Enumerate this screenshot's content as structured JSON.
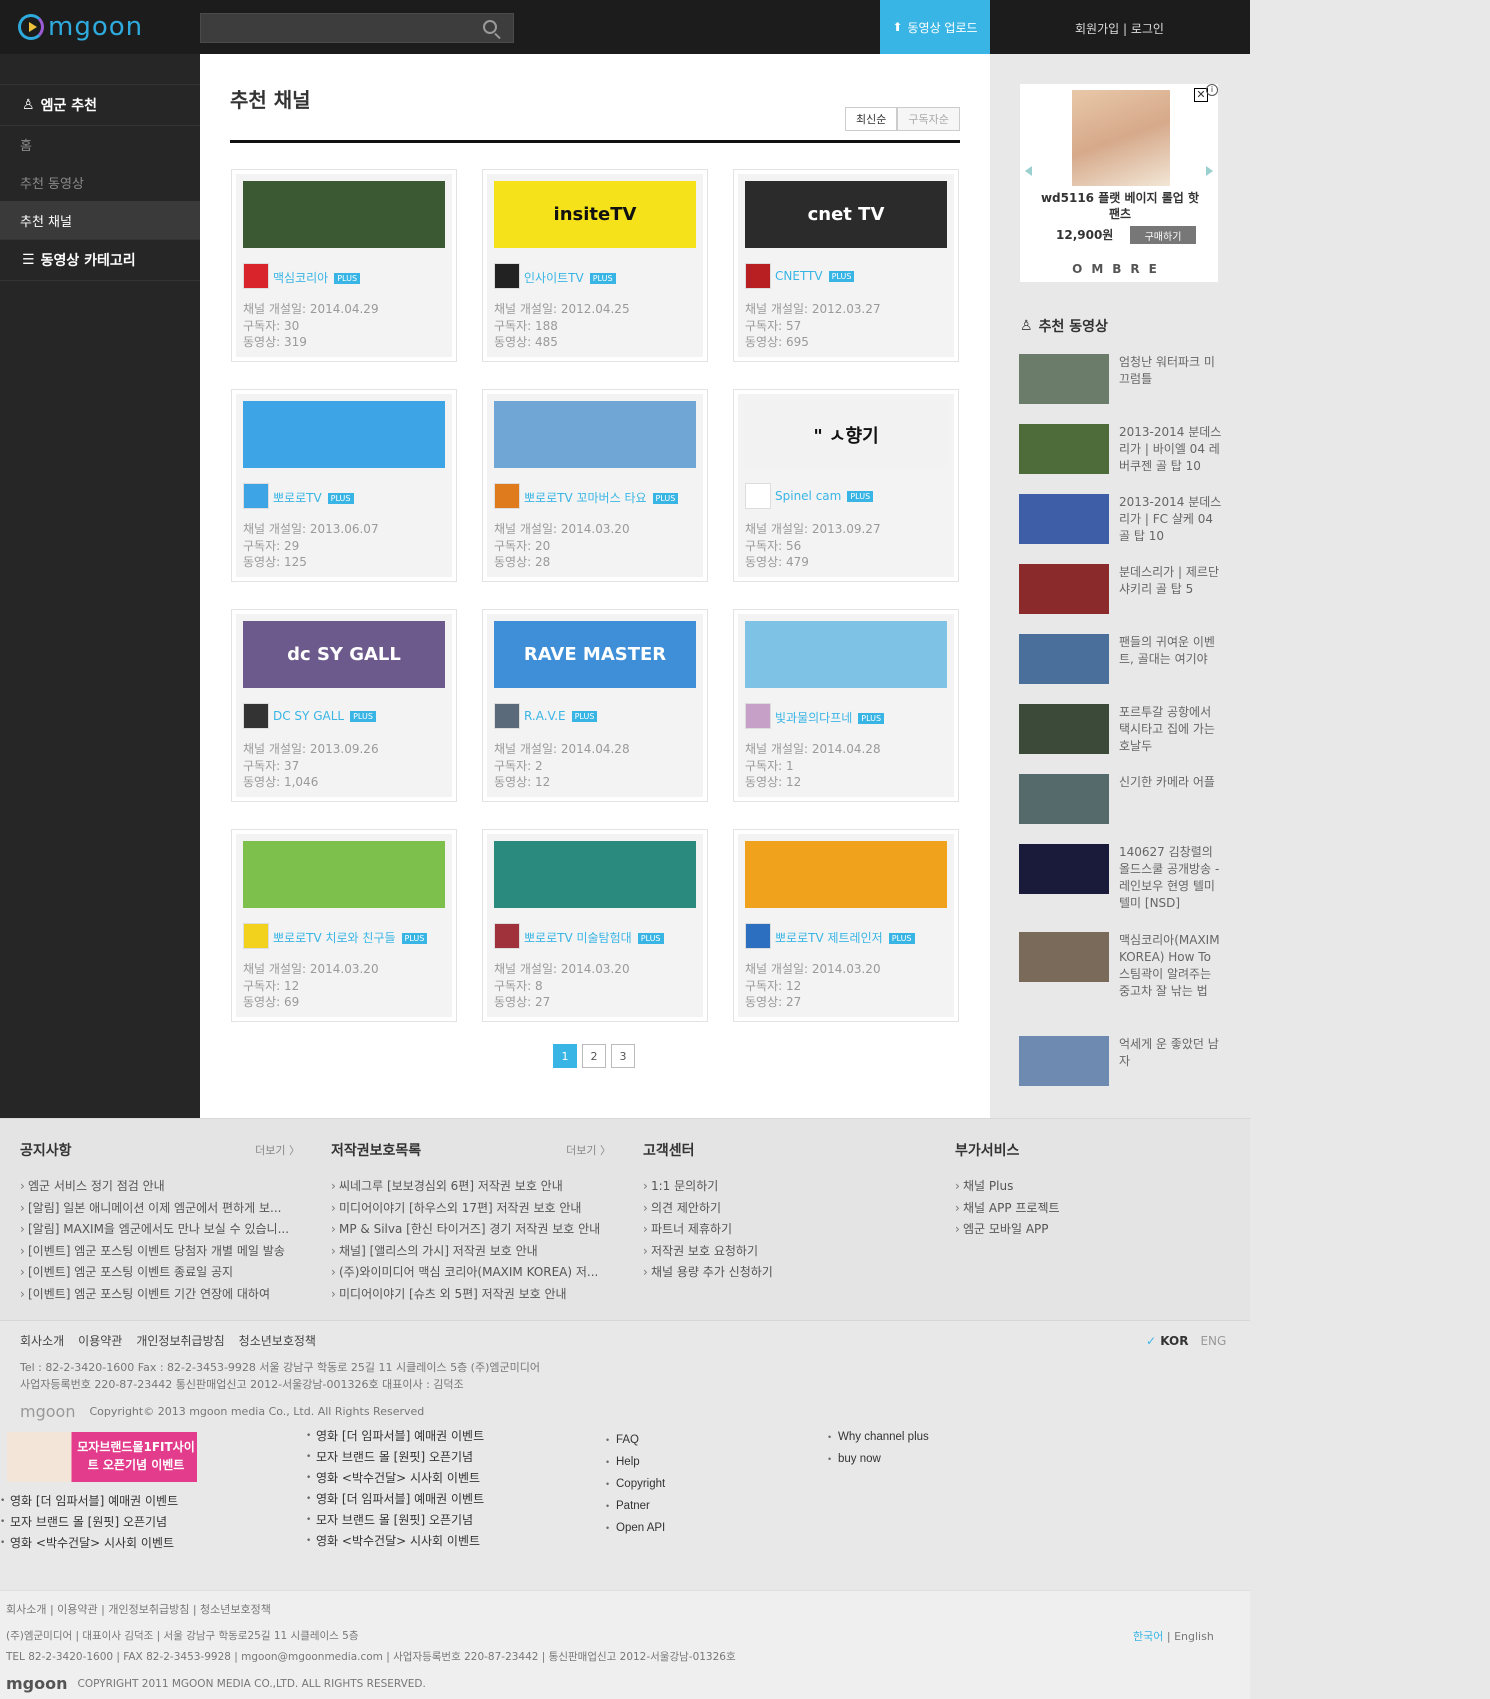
{
  "header": {
    "logo": "mgoon",
    "search_placeholder": "",
    "upload_label": "동영상 업로드",
    "login_label": "회원가입 | 로그인"
  },
  "sidebar": {
    "section1": "엠군 추천",
    "items": [
      {
        "label": "홈",
        "active": false
      },
      {
        "label": "추천 동영상",
        "active": false
      },
      {
        "label": "추천 채널",
        "active": true
      }
    ],
    "section2": "동영상 카테고리"
  },
  "main": {
    "title": "추천 채널",
    "sort": [
      {
        "label": "최신순",
        "active": true
      },
      {
        "label": "구독자순",
        "active": false
      }
    ],
    "channels": [
      {
        "name": "맥심코리아",
        "plus": "PLUS",
        "opened": "채널 개설일: 2014.04.29",
        "subs": "구독자: 30",
        "videos": "동영상: 319",
        "banner_color": "#3b5a33",
        "banner_text": "",
        "icon_color": "#d8242a"
      },
      {
        "name": "인사이트TV",
        "plus": "PLUS",
        "opened": "채널 개설일: 2012.04.25",
        "subs": "구독자: 188",
        "videos": "동영상: 485",
        "banner_color": "#f5e21a",
        "banner_text": "insiteTV",
        "icon_color": "#222222"
      },
      {
        "name": "CNETTV",
        "plus": "PLUS",
        "opened": "채널 개설일: 2012.03.27",
        "subs": "구독자: 57",
        "videos": "동영상: 695",
        "banner_color": "#2b2b2b",
        "banner_text": "cnet TV",
        "icon_color": "#b81f23"
      },
      {
        "name": "뽀로로TV",
        "plus": "PLUS",
        "opened": "채널 개설일: 2013.06.07",
        "subs": "구독자: 29",
        "videos": "동영상: 125",
        "banner_color": "#3da5e6",
        "banner_text": "",
        "icon_color": "#3da5e6"
      },
      {
        "name": "뽀로로TV 꼬마버스 타요",
        "plus": "PLUS",
        "opened": "채널 개설일: 2014.03.20",
        "subs": "구독자: 20",
        "videos": "동영상: 28",
        "banner_color": "#6fa6d6",
        "banner_text": "",
        "icon_color": "#e07b1d"
      },
      {
        "name": "Spinel cam",
        "plus": "PLUS",
        "opened": "채널 개설일: 2013.09.27",
        "subs": "구독자: 56",
        "videos": "동영상: 479",
        "banner_color": "#f2f2f2",
        "banner_text": "\" ㅅ향기",
        "icon_color": "#ffffff"
      },
      {
        "name": "DC SY GALL",
        "plus": "PLUS",
        "opened": "채널 개설일: 2013.09.26",
        "subs": "구독자: 37",
        "videos": "동영상: 1,046",
        "banner_color": "#6d5a8c",
        "banner_text": "dc SY GALL",
        "icon_color": "#333333"
      },
      {
        "name": "R.A.V.E",
        "plus": "PLUS",
        "opened": "채널 개설일: 2014.04.28",
        "subs": "구독자: 2",
        "videos": "동영상: 12",
        "banner_color": "#3e8fd8",
        "banner_text": "RAVE MASTER",
        "icon_color": "#5a6a7a"
      },
      {
        "name": "빛과물의다프네",
        "plus": "PLUS",
        "opened": "채널 개설일: 2014.04.28",
        "subs": "구독자: 1",
        "videos": "동영상: 12",
        "banner_color": "#7ec3e6",
        "banner_text": "",
        "icon_color": "#c7a0c8"
      },
      {
        "name": "뽀로로TV 치로와 친구들",
        "plus": "PLUS",
        "opened": "채널 개설일: 2014.03.20",
        "subs": "구독자: 12",
        "videos": "동영상: 69",
        "banner_color": "#7dc04c",
        "banner_text": "",
        "icon_color": "#f2d21c"
      },
      {
        "name": "뽀로로TV 미술탐험대",
        "plus": "PLUS",
        "opened": "채널 개설일: 2014.03.20",
        "subs": "구독자: 8",
        "videos": "동영상: 27",
        "banner_color": "#2a8a7e",
        "banner_text": "",
        "icon_color": "#a0323c"
      },
      {
        "name": "뽀로로TV 제트레인저",
        "plus": "PLUS",
        "opened": "채널 개설일: 2014.03.20",
        "subs": "구독자: 12",
        "videos": "동영상: 27",
        "banner_color": "#f1a21c",
        "banner_text": "",
        "icon_color": "#2c6fc0"
      }
    ],
    "pages": [
      "1",
      "2",
      "3"
    ]
  },
  "right": {
    "ad": {
      "name": "wd5116 플랫 베이지 롤업 핫팬츠",
      "price": "12,900원",
      "buy": "구매하기",
      "brand": "OMBRE"
    },
    "rec_title": "추천 동영상",
    "videos": [
      {
        "title": "엄청난 워터파크 미끄럼틀",
        "color": "#6b7d6a"
      },
      {
        "title": "2013-2014 분데스리가 | 바이엘 04 레버쿠젠 골 탑 10",
        "color": "#4e6b3a"
      },
      {
        "title": "2013-2014 분데스리가 | FC 샬케 04 골 탑 10",
        "color": "#3f5ea8"
      },
      {
        "title": "분데스리가 | 제르단 샤키리 골 탑 5",
        "color": "#8a2a2a"
      },
      {
        "title": "팬들의 귀여운 이벤트, 골대는 여기야",
        "color": "#4a6f9a"
      },
      {
        "title": "포르투갈 공항에서 택시타고 집에 가는 호날두",
        "color": "#3c4a3a"
      },
      {
        "title": "신기한 카메라 어플",
        "color": "#556a6a"
      },
      {
        "title": "140627 김창렬의 올드스쿨 공개방송 - 레인보우 현영 텔미텔미 [NSD]",
        "color": "#1a1a3a"
      },
      {
        "title": "맥심코리아(MAXIM KOREA) How To 스팀곽이 알려주는 중고차 잘 낚는 법",
        "color": "#7a6a5a"
      },
      {
        "title": "억세게 운 좋았던 남자",
        "color": "#6e8ab0"
      }
    ]
  },
  "footer": {
    "cols": [
      {
        "title": "공지사항",
        "more": "더보기 〉",
        "items": [
          "엠군 서비스 정기 점검 안내",
          "[알림] 일본 애니메이션 이제 엠군에서 편하게 보...",
          "[알림] MAXIM을 엠군에서도 만나 보실 수 있습니...",
          "[이벤트] 엠군 포스팅 이벤트 당첨자 개별 메일 발송",
          "[이벤트] 엠군 포스팅 이벤트 종료일 공지",
          "[이벤트] 엠군 포스팅 이벤트 기간 연장에 대하여"
        ]
      },
      {
        "title": "저작권보호목록",
        "more": "더보기 〉",
        "items": [
          "씨네그루 [보보경심외 6편] 저작권 보호 안내",
          "미디어이야기 [하우스외 17편] 저작권 보호 안내",
          "MP & Silva [한신 타이거즈] 경기 저작권 보호 안내",
          "채널] [앨리스의 가시] 저작권 보호 안내",
          "(주)와이미디어 맥심 코리아(MAXIM KOREA) 저...",
          "미디어이야기 [슈츠 외 5편] 저작권 보호 안내"
        ]
      },
      {
        "title": "고객센터",
        "more": "",
        "items": [
          "1:1 문의하기",
          "의견 제안하기",
          "파트너 제휴하기",
          "저작권 보호 요청하기",
          "채널 용량 추가 신청하기"
        ]
      },
      {
        "title": "부가서비스",
        "more": "",
        "items": [
          "채널 Plus",
          "채널 APP 프로젝트",
          "엠군 모바일 APP"
        ]
      }
    ],
    "links": [
      "회사소개",
      "이용약관",
      "개인정보취급방침",
      "청소년보호정책"
    ],
    "info1": "Tel : 82-2-3420-1600     Fax : 82-2-3453-9928     서울 강남구 학동로 25길 11 시클레이스 5층 (주)엠군미디어",
    "info2": "사업자등록번호 220-87-23442     통신판매업신고 2012-서울강남-001326호     대표이사 : 김덕조",
    "copyright": "Copyright© 2013 mgoon media Co., Ltd. All Rights Reserved",
    "logo": "mgoon",
    "lang_kor": "KOR",
    "lang_eng": "ENG"
  },
  "old": {
    "ad_text": "모자브랜드몰1FIT사이트 오픈기념 이벤트",
    "list_left": [
      "영화 [더 임파서블] 예매권 이벤트",
      "모자 브랜드 몰 [원핏] 오픈기념",
      "영화 <박수건달> 시사회 이벤트"
    ],
    "list_mid": [
      "영화 [더 임파서블] 예매권 이벤트",
      "모자 브랜드 몰 [원핏] 오픈기념",
      "영화 <박수건달> 시사회 이벤트",
      "영화 [더 임파서블] 예매권 이벤트",
      "모자 브랜드 몰 [원핏] 오픈기념",
      "영화 <박수건달> 시사회 이벤트"
    ],
    "list_help": [
      "FAQ",
      "Help",
      "Copyright",
      "Patner",
      "Open API"
    ],
    "list_plus": [
      "Why channel plus",
      "buy now"
    ],
    "links": "회사소개 | 이용약관 | 개인정보취급방침 | 청소년보호정책",
    "addr1": "(주)엠군미디어  |  대표이사 김덕조  |  서울 강남구 학동로25길 11 시클레이스 5층",
    "addr2": "TEL 82-2-3420-1600  |  FAX 82-2-3453-9928  |  mgoon@mgoonmedia.com  |  사업자등록번호 220-87-23442  |  통신판매업신고 2012-서울강남-01326호",
    "lang_k": "한국어",
    "lang_e": "English",
    "logo": "mgoon",
    "copyright": "COPYRIGHT 2011 MGOON MEDIA CO.,LTD. ALL RIGHTS RESERVED."
  }
}
